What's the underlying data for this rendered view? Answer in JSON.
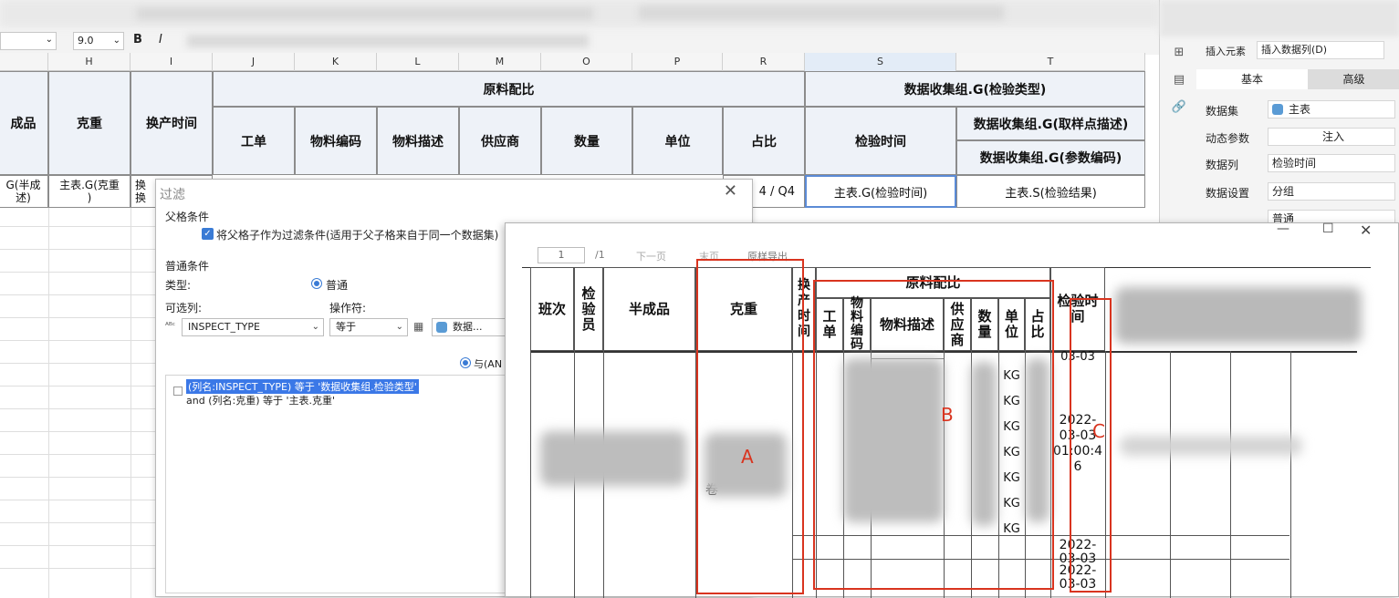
{
  "toolbar": {
    "font_size": "9.0",
    "bold_icon": "B",
    "italic_icon": "I"
  },
  "columns": [
    "H",
    "I",
    "J",
    "K",
    "L",
    "M",
    "O",
    "P",
    "R",
    "S",
    "T"
  ],
  "sheet": {
    "header_group_raw": "原料配比",
    "header_group_data": "数据收集组.G(检验类型)",
    "col_finished": "成品",
    "col_weight": "克重",
    "col_change_time": "换产时间",
    "col_order": "工单",
    "col_material_code": "物料编码",
    "col_material_desc": "物料描述",
    "col_supplier": "供应商",
    "col_quantity": "数量",
    "col_unit": "单位",
    "col_ratio": "占比",
    "col_inspect_time": "检验时间",
    "col_sample_desc": "数据收集组.G(取样点描述)",
    "col_param_code": "数据收集组.G(参数编码)",
    "row_semifinished": "G(半成\n述)",
    "row_weight": "主表.G(克重\n)",
    "row_change": "换\n换",
    "row_ratio": "4 / Q4",
    "row_inspect_time": "主表.G(检验时间)",
    "row_result": "主表.S(检验结果)"
  },
  "right_panel": {
    "insert_element_label": "插入元素",
    "insert_element_value": "插入数据列(D)",
    "tab_basic": "基本",
    "tab_advanced": "高级",
    "dataset_label": "数据集",
    "dataset_value": "主表",
    "dynamic_param_label": "动态参数",
    "dynamic_param_value": "注入",
    "data_column_label": "数据列",
    "data_column_value": "检验时间",
    "data_setting_label": "数据设置",
    "data_setting_value": "分组",
    "normal_value": "普通"
  },
  "filter_dialog": {
    "title": "过滤",
    "parent_section": "父格条件",
    "parent_checkbox_label": "将父格子作为过滤条件(适用于父子格来自于同一个数据集)",
    "normal_section": "普通条件",
    "type_label": "类型:",
    "type_value": "普通",
    "optional_col_label": "可选列:",
    "operator_label": "操作符:",
    "optional_col_value": "INSPECT_TYPE",
    "operator_value": "等于",
    "dataset_combo_value": "数据...",
    "and_label": "与(AN",
    "condition_1": "(列名:INSPECT_TYPE) 等于 '数据收集组.检验类型'",
    "condition_2": "and (列名:克重) 等于 '主表.克重'"
  },
  "preview": {
    "page_input": "1",
    "page_total": "/1",
    "next_page": "下一页",
    "last_page": "末页",
    "export": "原样导出",
    "h_shift": "班次",
    "h_inspector": "检\n验\n员",
    "h_semifinished": "半成品",
    "h_weight": "克重",
    "h_change_time": "换\n产\n时\n间",
    "h_raw_ratio": "原料配比",
    "h_order": "工\n单",
    "h_material_code": "物\n料\n编\n码",
    "h_material_desc": "物料描述",
    "h_supplier": "供\n应\n商",
    "h_quantity": "数\n量",
    "h_unit": "单\n位",
    "h_ratio": "占\n比",
    "h_inspect_time": "检验时\n间",
    "units": [
      "KG",
      "KG",
      "KG",
      "KG",
      "KG",
      "KG",
      "KG"
    ],
    "date_top": "03-03",
    "datetime_main": "2022-\n03-03\n01:00:4\n6",
    "date_bottom_1": "2022-\n03-03",
    "date_bottom_2": "2022-\n03-03",
    "weight_cell_text": "卷",
    "label_a": "A",
    "label_b": "B",
    "label_c": "C"
  }
}
